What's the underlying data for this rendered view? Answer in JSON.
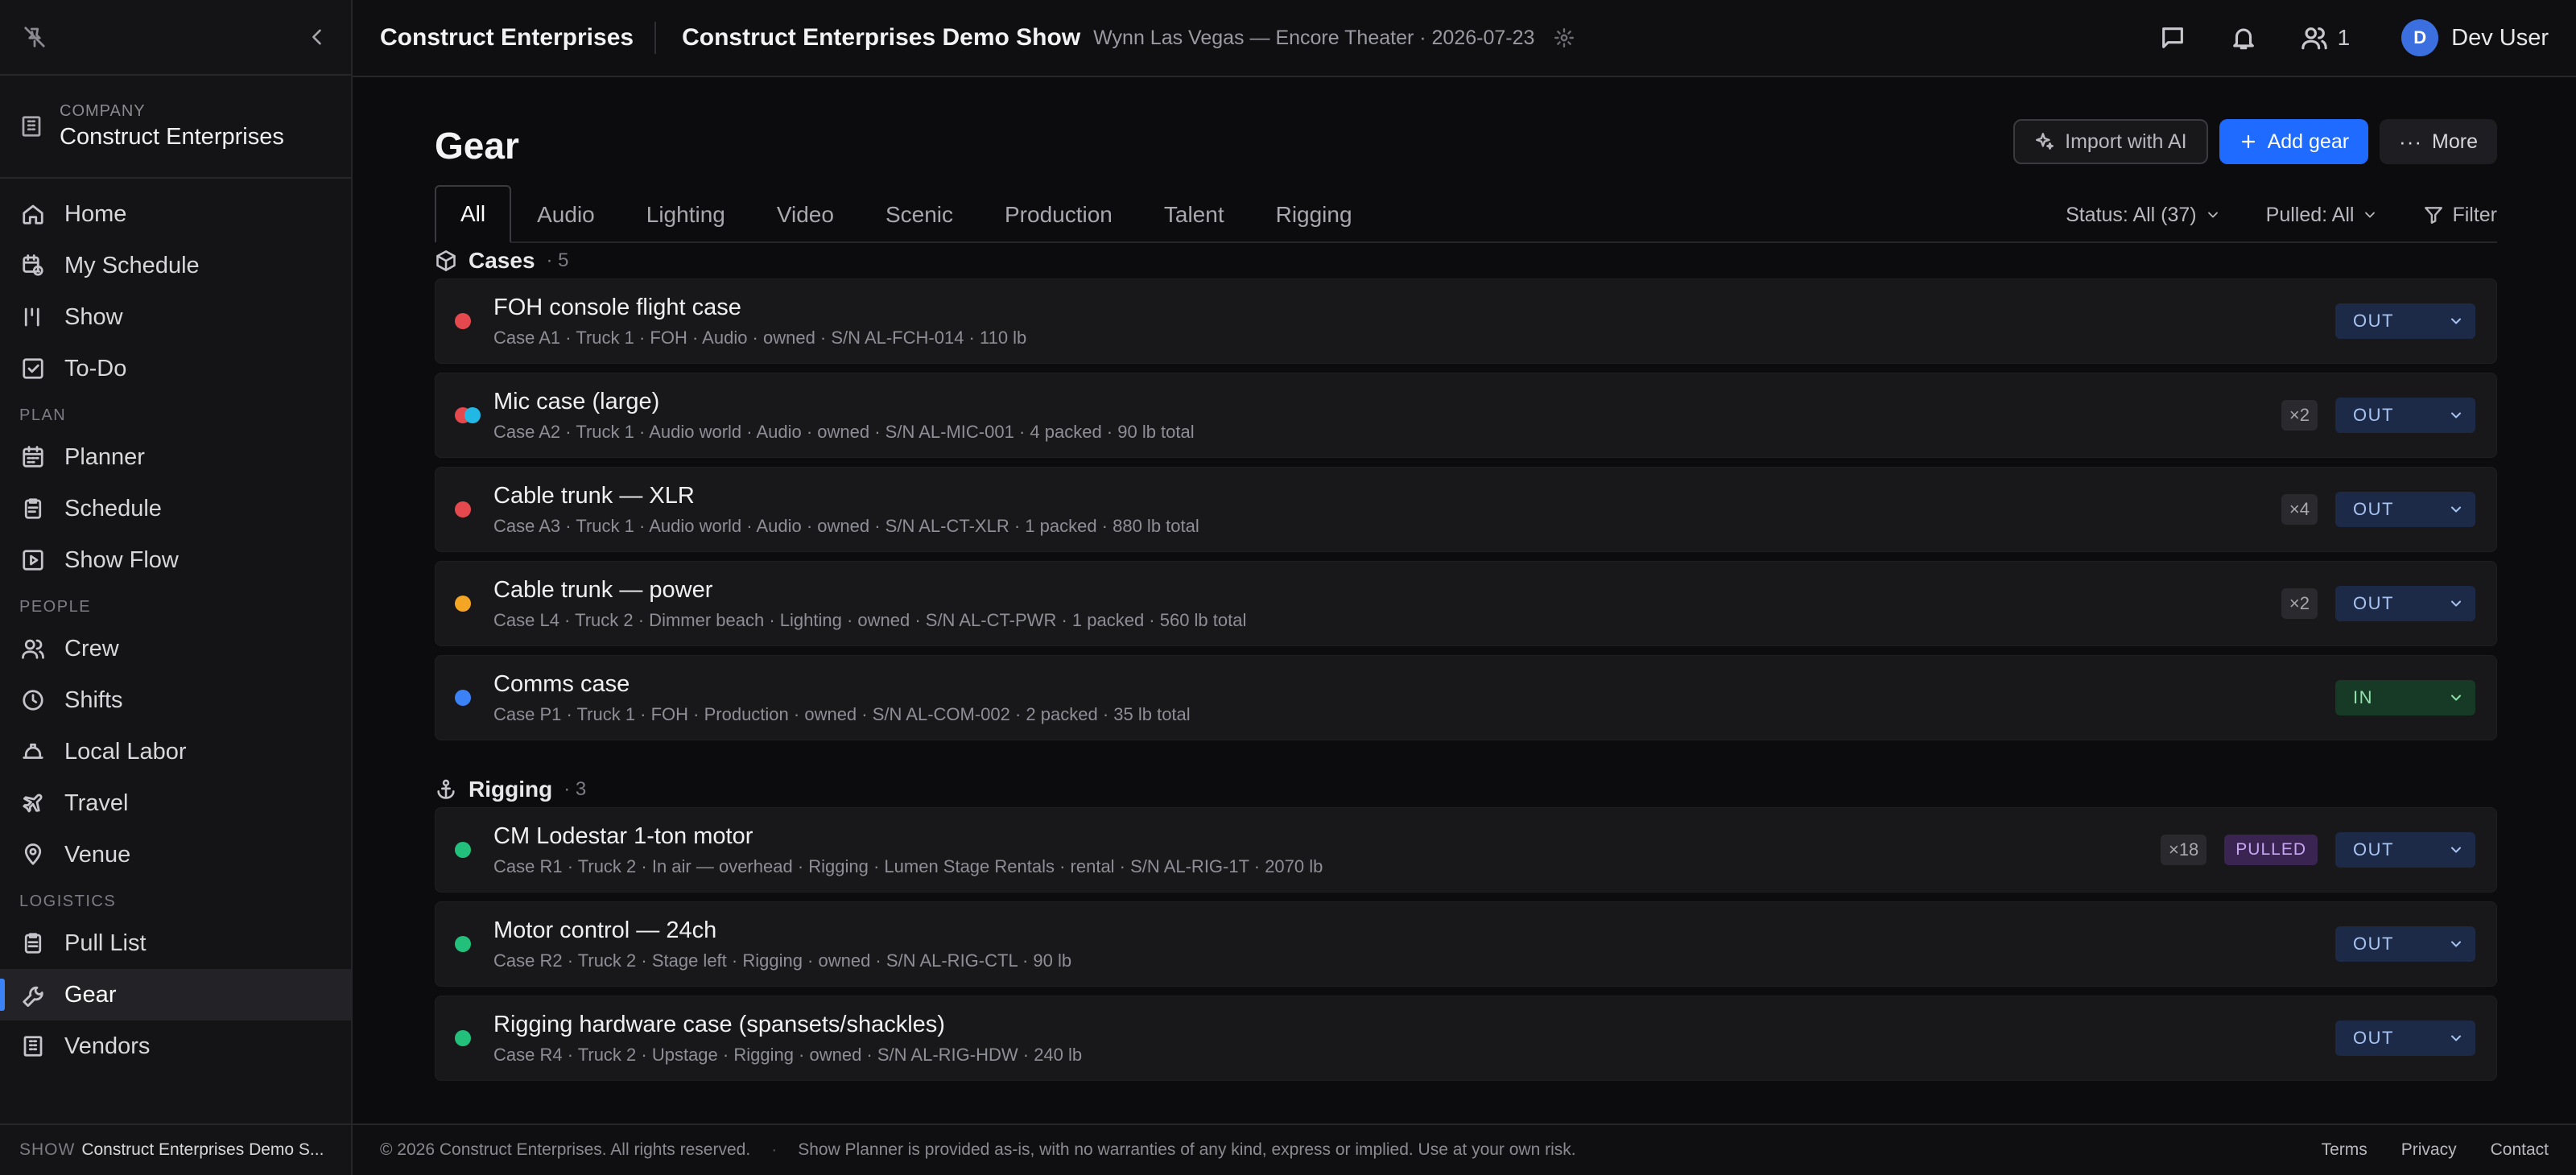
{
  "sidebar": {
    "company_label": "COMPANY",
    "company_name": "Construct Enterprises",
    "items_main": [
      "Home",
      "My Schedule",
      "Show",
      "To-Do"
    ],
    "section_plan": "PLAN",
    "items_plan": [
      "Planner",
      "Schedule",
      "Show Flow"
    ],
    "section_people": "PEOPLE",
    "items_people": [
      "Crew",
      "Shifts",
      "Local Labor",
      "Travel",
      "Venue"
    ],
    "section_logistics": "LOGISTICS",
    "items_logistics": [
      "Pull List",
      "Gear",
      "Vendors"
    ],
    "footer_label": "SHOW",
    "footer_value": "Construct Enterprises Demo S..."
  },
  "topbar": {
    "brand": "Construct Enterprises",
    "show_title": "Construct Enterprises Demo Show",
    "venue": "Wynn Las Vegas — Encore Theater · 2026-07-23",
    "crew_count": "1",
    "avatar_initial": "D",
    "user_name": "Dev User"
  },
  "page": {
    "title": "Gear",
    "import_label": "Import with AI",
    "add_label": "Add gear",
    "more_label": "More",
    "tabs": [
      "All",
      "Audio",
      "Lighting",
      "Video",
      "Scenic",
      "Production",
      "Talent",
      "Rigging"
    ],
    "status_filter": "Status: All (37)",
    "pulled_filter": "Pulled: All",
    "filter_label": "Filter"
  },
  "colors": {
    "accent": "#1f6bff",
    "red": "#e5484d",
    "orange": "#f5a524",
    "blue": "#3b82f6",
    "cyan": "#22b8e6",
    "green": "#22c07a"
  },
  "groups": [
    {
      "name": "Cases",
      "count": "· 5",
      "icon": "box-icon",
      "items": [
        {
          "name": "FOH console flight case",
          "meta": "Case A1 · Truck 1 · FOH · Audio · owned · S/N AL-FCH-014 · 110 lb",
          "dots": [
            "red"
          ],
          "qty": "",
          "pulled": "",
          "status": "OUT"
        },
        {
          "name": "Mic case (large)",
          "meta": "Case A2 · Truck 1 · Audio world · Audio · owned · S/N AL-MIC-001 · 4 packed · 90 lb total",
          "dots": [
            "red",
            "cyan"
          ],
          "qty": "×2",
          "pulled": "",
          "status": "OUT"
        },
        {
          "name": "Cable trunk — XLR",
          "meta": "Case A3 · Truck 1 · Audio world · Audio · owned · S/N AL-CT-XLR · 1 packed · 880 lb total",
          "dots": [
            "red"
          ],
          "qty": "×4",
          "pulled": "",
          "status": "OUT"
        },
        {
          "name": "Cable trunk — power",
          "meta": "Case L4 · Truck 2 · Dimmer beach · Lighting · owned · S/N AL-CT-PWR · 1 packed · 560 lb total",
          "dots": [
            "orange"
          ],
          "qty": "×2",
          "pulled": "",
          "status": "OUT"
        },
        {
          "name": "Comms case",
          "meta": "Case P1 · Truck 1 · FOH · Production · owned · S/N AL-COM-002 · 2 packed · 35 lb total",
          "dots": [
            "blue"
          ],
          "qty": "",
          "pulled": "",
          "status": "IN"
        }
      ]
    },
    {
      "name": "Rigging",
      "count": "· 3",
      "icon": "anchor-icon",
      "items": [
        {
          "name": "CM Lodestar 1-ton motor",
          "meta": "Case R1 · Truck 2 · In air — overhead · Rigging · Lumen Stage Rentals · rental · S/N AL-RIG-1T · 2070 lb",
          "dots": [
            "green"
          ],
          "qty": "×18",
          "pulled": "PULLED",
          "status": "OUT"
        },
        {
          "name": "Motor control — 24ch",
          "meta": "Case R2 · Truck 2 · Stage left · Rigging · owned · S/N AL-RIG-CTL · 90 lb",
          "dots": [
            "green"
          ],
          "qty": "",
          "pulled": "",
          "status": "OUT"
        },
        {
          "name": "Rigging hardware case (spansets/shackles)",
          "meta": "Case R4 · Truck 2 · Upstage · Rigging · owned · S/N AL-RIG-HDW · 240 lb",
          "dots": [
            "green"
          ],
          "qty": "",
          "pulled": "",
          "status": "OUT"
        }
      ]
    }
  ],
  "footer": {
    "copyright": "© 2026 Construct Enterprises. All rights reserved.",
    "disclaimer": "Show Planner is provided as-is, with no warranties of any kind, express or implied. Use at your own risk.",
    "links": [
      "Terms",
      "Privacy",
      "Contact"
    ]
  }
}
